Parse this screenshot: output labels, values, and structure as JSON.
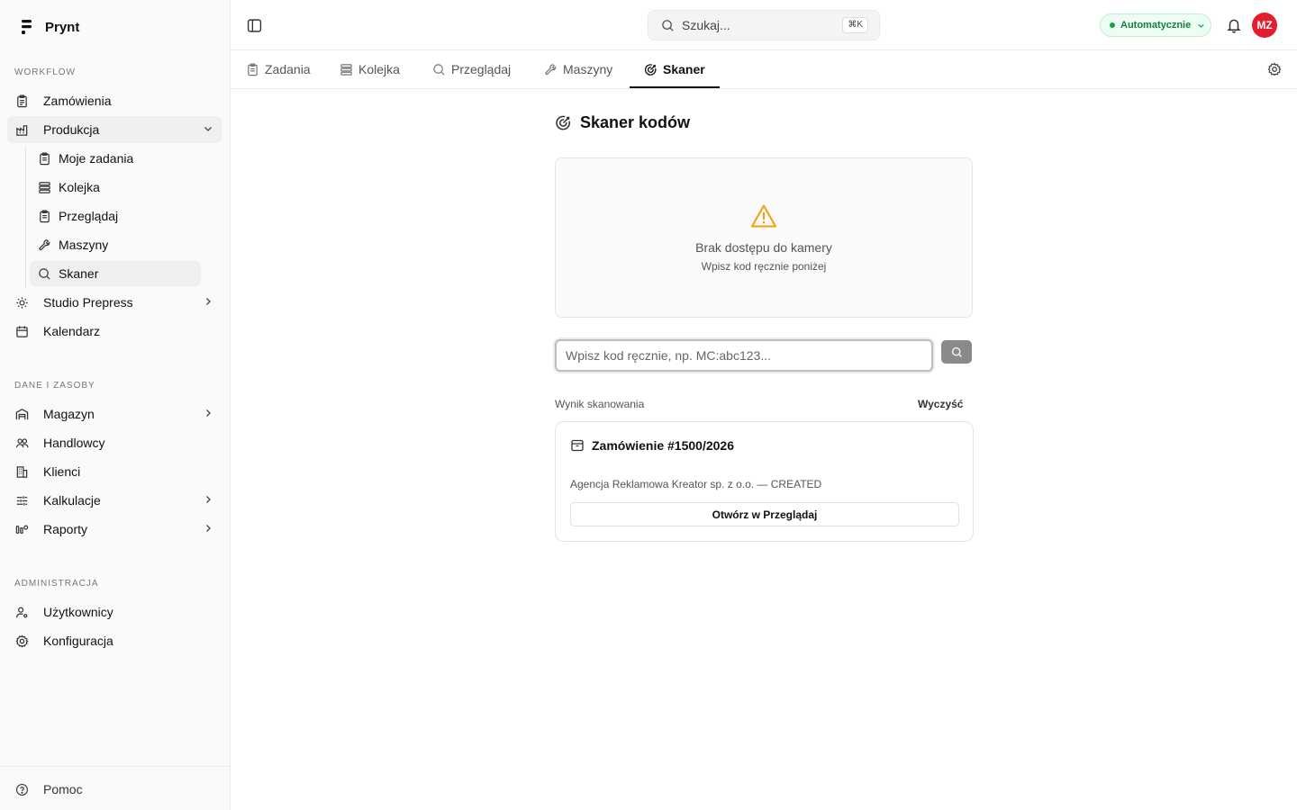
{
  "app": {
    "name": "Prynt"
  },
  "sidebar": {
    "sections": {
      "workflow": "WORKFLOW",
      "data": "DANE I ZASOBY",
      "admin": "ADMINISTRACJA"
    },
    "workflow_items": {
      "orders": "Zamówienia",
      "production": "Produkcja",
      "studio": "Studio Prepress",
      "calendar": "Kalendarz"
    },
    "production_sub": {
      "my_tasks": "Moje zadania",
      "queue": "Kolejka",
      "browse": "Przeglądaj",
      "machines": "Maszyny",
      "scanner": "Skaner"
    },
    "data_items": {
      "warehouse": "Magazyn",
      "sales": "Handlowcy",
      "clients": "Klienci",
      "calculations": "Kalkulacje",
      "reports": "Raporty"
    },
    "admin_items": {
      "users": "Użytkownicy",
      "config": "Konfiguracja"
    },
    "help": "Pomoc"
  },
  "topbar": {
    "search_placeholder": "Szukaj...",
    "search_shortcut": "⌘K",
    "mode_label": "Automatycznie",
    "avatar_initials": "MZ"
  },
  "tabs": {
    "tasks": "Zadania",
    "queue": "Kolejka",
    "browse": "Przeglądaj",
    "machines": "Maszyny",
    "scanner": "Skaner"
  },
  "scanner": {
    "title": "Skaner kodów",
    "camera_error_title": "Brak dostępu do kamery",
    "camera_error_hint": "Wpisz kod ręcznie poniżej",
    "input_placeholder": "Wpisz kod ręcznie, np. MC:abc123...",
    "result_label": "Wynik skanowania",
    "clear_label": "Wyczyść",
    "result": {
      "title": "Zamówienie #1500/2026",
      "description": "Agencja Reklamowa Kreator sp. z o.o. — CREATED",
      "open_button": "Otwórz w Przeglądaj"
    }
  },
  "colors": {
    "accent_status": "#16a34a",
    "avatar": "#e11d2e",
    "warning": "#f59e0b"
  }
}
